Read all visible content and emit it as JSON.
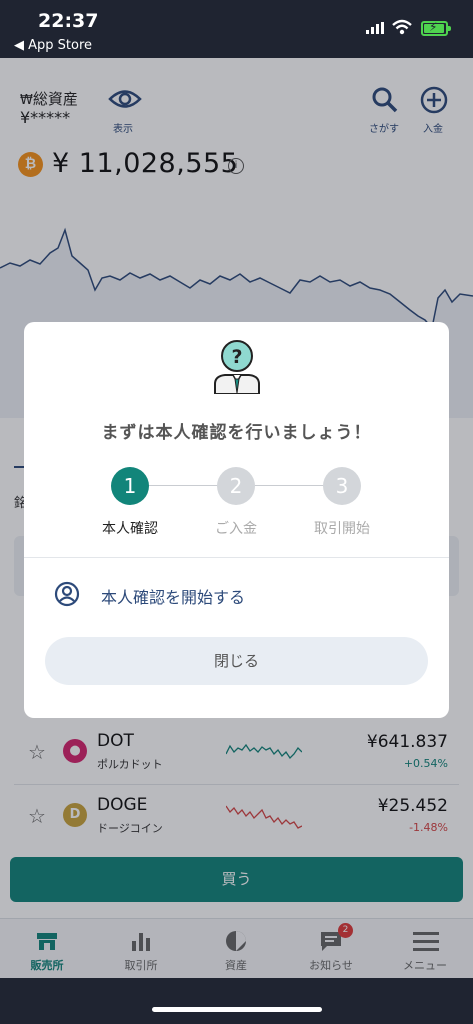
{
  "status_bar": {
    "time": "22:37",
    "back_label": "◀ App Store"
  },
  "header": {
    "title": "総資産",
    "masked_value": "¥*****",
    "show_label": "表示",
    "search_label": "さがす",
    "deposit_label": "入金"
  },
  "balance": {
    "amount": "¥ 11,028,555",
    "coin_symbol": "₿"
  },
  "behind_modal_text": "銘",
  "coins": [
    {
      "symbol": "DOT",
      "name": "ポルカドット",
      "price": "¥641.837",
      "change": "+0.54%",
      "trend": "up",
      "logo_color": "#d6246e",
      "logo_char": "●"
    },
    {
      "symbol": "DOGE",
      "name": "ドージコイン",
      "price": "¥25.452",
      "change": "-1.48%",
      "trend": "down",
      "logo_color": "#c9a43c",
      "logo_char": "D"
    }
  ],
  "buy_button": "買う",
  "nav": [
    {
      "label": "販売所",
      "icon": "store-icon",
      "active": true
    },
    {
      "label": "取引所",
      "icon": "bar-chart-icon"
    },
    {
      "label": "資産",
      "icon": "pie-chart-icon"
    },
    {
      "label": "お知らせ",
      "icon": "message-icon",
      "badge": "2"
    },
    {
      "label": "メニュー",
      "icon": "hamburger-icon"
    }
  ],
  "modal": {
    "title": "まずは本人確認を行いましょう！",
    "steps": [
      {
        "num": "1",
        "label": "本人確認",
        "active": true
      },
      {
        "num": "2",
        "label": "ご入金"
      },
      {
        "num": "3",
        "label": "取引開始"
      }
    ],
    "start_link": "本人確認を開始する",
    "close_button": "閉じる"
  },
  "colors": {
    "accent": "#12857a",
    "link": "#2d4a7a",
    "up": "#12857a",
    "down": "#d64545"
  }
}
